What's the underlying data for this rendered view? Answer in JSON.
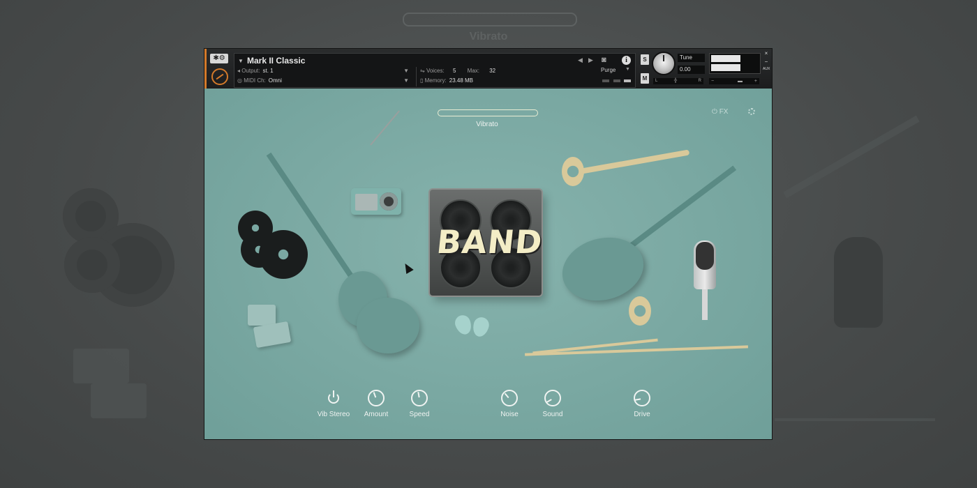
{
  "background": {
    "title": "Vibrato"
  },
  "header": {
    "instrument_name": "Mark II Classic",
    "output_label": "Output:",
    "output_value": "st. 1",
    "midi_label": "MIDI Ch:",
    "midi_value": "Omni",
    "voices_label": "Voices:",
    "voices_value": "5",
    "max_label": "Max:",
    "max_value": "32",
    "memory_label": "Memory:",
    "memory_value": "23.48 MB",
    "purge_label": "Purge",
    "solo_label": "S",
    "mute_label": "M",
    "tune_label": "Tune",
    "tune_value": "0.00",
    "pan_left": "L",
    "pan_right": "R",
    "vol_minus": "−",
    "vol_plus": "+",
    "logo_label": "✱⚙",
    "aux_label": "AUX",
    "close_label": "×",
    "minimize_label": "−"
  },
  "main": {
    "vibrato_label": "Vibrato",
    "fx_label": "FX",
    "amp_text": "BAND",
    "controls": [
      {
        "label": "Vib Stereo"
      },
      {
        "label": "Amount"
      },
      {
        "label": "Speed"
      },
      {
        "label": "Noise"
      },
      {
        "label": "Sound"
      },
      {
        "label": "Drive"
      }
    ]
  },
  "colors": {
    "accent": "#d47a2a",
    "body_bg": "#7aa8a2",
    "amp_text": "#f3edc6"
  }
}
